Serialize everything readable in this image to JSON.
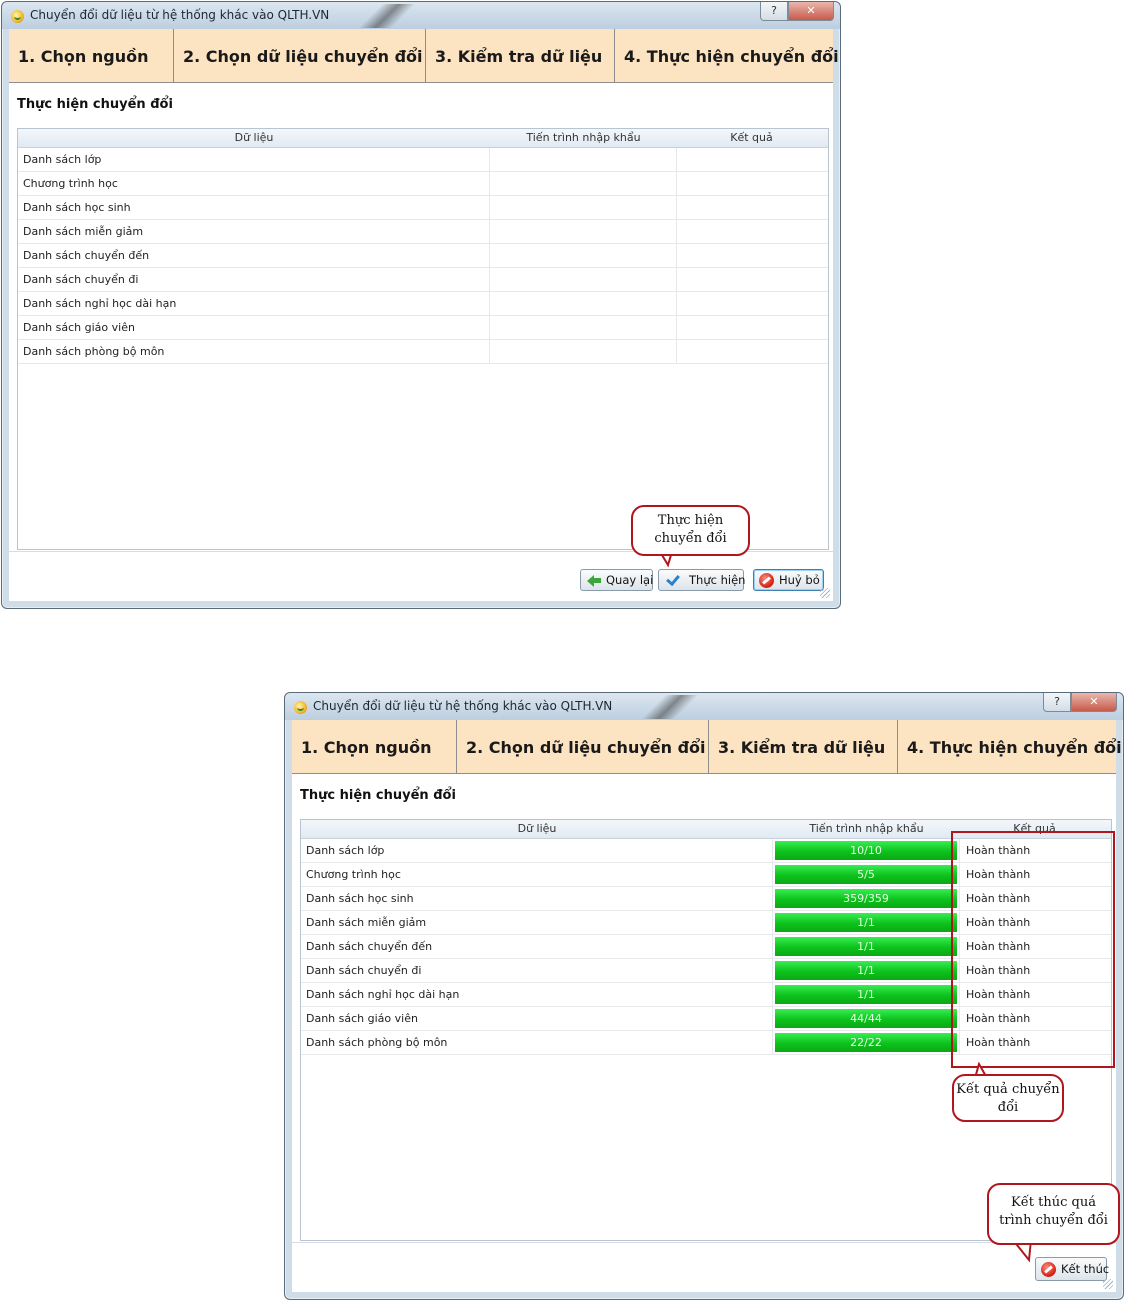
{
  "window": {
    "title": "Chuyển đổi dữ liệu từ hệ thống khác vào QLTH.VN",
    "help_label": "?",
    "close_label": "✕"
  },
  "steps": [
    "1. Chọn nguồn",
    "2. Chọn dữ liệu chuyển đổi",
    "3. Kiểm tra dữ liệu",
    "4. Thực hiện chuyển đổi"
  ],
  "section_title": "Thực hiện chuyển đổi",
  "columns": {
    "data": "Dữ liệu",
    "progress": "Tiến trình nhập khẩu",
    "result": "Kết quả"
  },
  "before": {
    "rows": [
      {
        "name": "Danh sách lớp"
      },
      {
        "name": "Chương trình học"
      },
      {
        "name": "Danh sách học sinh"
      },
      {
        "name": "Danh sách miễn giảm"
      },
      {
        "name": "Danh sách chuyển đến"
      },
      {
        "name": "Danh sách chuyển đi"
      },
      {
        "name": "Danh sách nghỉ học dài hạn"
      },
      {
        "name": "Danh sách giáo viên"
      },
      {
        "name": "Danh sách phòng bộ môn"
      }
    ],
    "buttons": {
      "back": "Quay lại",
      "run": "Thực hiện",
      "cancel": "Huỷ bỏ"
    },
    "callout": "Thực hiện chuyển đổi"
  },
  "after": {
    "rows": [
      {
        "name": "Danh sách lớp",
        "progress": "10/10",
        "result": "Hoàn thành"
      },
      {
        "name": "Chương trình học",
        "progress": "5/5",
        "result": "Hoàn thành"
      },
      {
        "name": "Danh sách học sinh",
        "progress": "359/359",
        "result": "Hoàn thành"
      },
      {
        "name": "Danh sách miễn giảm",
        "progress": "1/1",
        "result": "Hoàn thành"
      },
      {
        "name": "Danh sách chuyển đến",
        "progress": "1/1",
        "result": "Hoàn thành"
      },
      {
        "name": "Danh sách chuyển đi",
        "progress": "1/1",
        "result": "Hoàn thành"
      },
      {
        "name": "Danh sách nghỉ học dài hạn",
        "progress": "1/1",
        "result": "Hoàn thành"
      },
      {
        "name": "Danh sách giáo viên",
        "progress": "44/44",
        "result": "Hoàn thành"
      },
      {
        "name": "Danh sách phòng bộ môn",
        "progress": "22/22",
        "result": "Hoàn thành"
      }
    ],
    "buttons": {
      "finish": "Kết thúc"
    },
    "callout_result": "Kết quả chuyển đổi",
    "callout_finish": "Kết thúc quá trình chuyển đổi"
  },
  "colors": {
    "step_bar": "#fce3c2",
    "progress_green": "#1fd630",
    "callout_border": "#b0161e"
  }
}
